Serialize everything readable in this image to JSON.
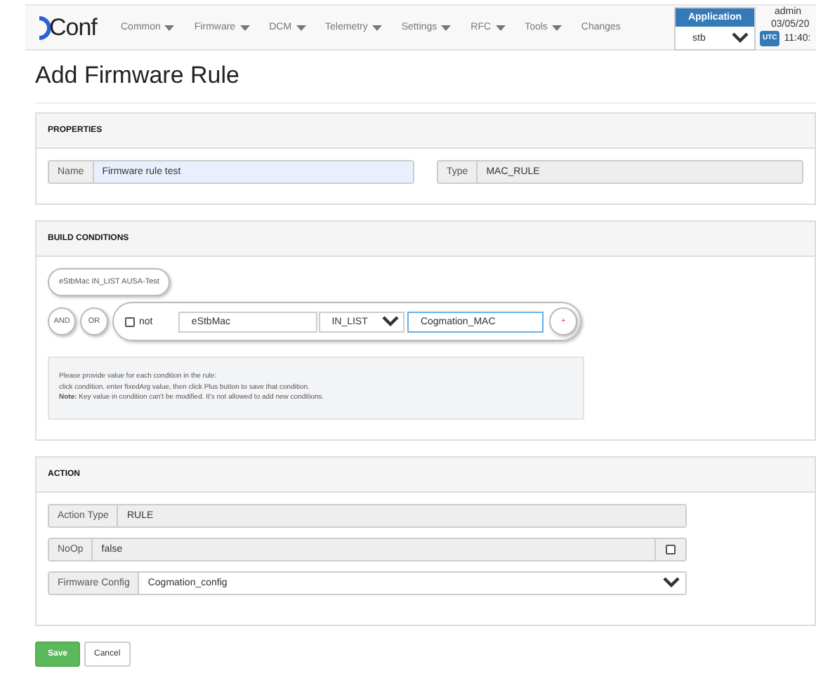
{
  "navbar": {
    "logo": "Conf",
    "menu": [
      {
        "label": "Common",
        "dropdown": true
      },
      {
        "label": "Firmware",
        "dropdown": true
      },
      {
        "label": "DCM",
        "dropdown": true
      },
      {
        "label": "Telemetry",
        "dropdown": true
      },
      {
        "label": "Settings",
        "dropdown": true
      },
      {
        "label": "RFC",
        "dropdown": true
      },
      {
        "label": "Tools",
        "dropdown": true
      },
      {
        "label": "Changes",
        "dropdown": false
      }
    ],
    "application": {
      "label": "Application",
      "value": "stb"
    },
    "user": "admin",
    "date": "03/05/20",
    "timezone": "UTC",
    "time": "11:40:"
  },
  "title": "Add Firmware Rule",
  "properties": {
    "title": "PROPERTIES",
    "fields": [
      {
        "label": "Name",
        "value": "Firmware rule test",
        "readonly": false,
        "focused": true
      },
      {
        "label": "Type",
        "value": "MAC_RULE",
        "readonly": true,
        "focused": false
      }
    ]
  },
  "build_conditions": {
    "title": "BUILD CONDITIONS",
    "summary": "eStbMac  IN_LIST  AUSA-Test",
    "operators": [
      "AND",
      "OR"
    ],
    "negate": {
      "label": "not",
      "checked": false
    },
    "key": "eStbMac",
    "operation": "IN_LIST",
    "value": "Cogmation_MAC",
    "add_label": "+",
    "help": [
      "Please provide value for each condition in the rule:",
      "click condition, enter fixedArg value, then click Plus button to save that condition.",
      "**Note:** Key value in condition can't be modified. It's not allowed to add new conditions."
    ]
  },
  "action": {
    "title": "ACTION",
    "fields": [
      {
        "kind": "text",
        "label": "Action Type",
        "value": "RULE"
      },
      {
        "kind": "checkbox",
        "label": "NoOp",
        "value": "false",
        "checked": false
      },
      {
        "kind": "select",
        "label": "Firmware Config",
        "value": "Cogmation_config"
      }
    ]
  },
  "buttons": [
    {
      "label": "Save",
      "primary": true
    },
    {
      "label": "Cancel",
      "primary": false
    }
  ]
}
